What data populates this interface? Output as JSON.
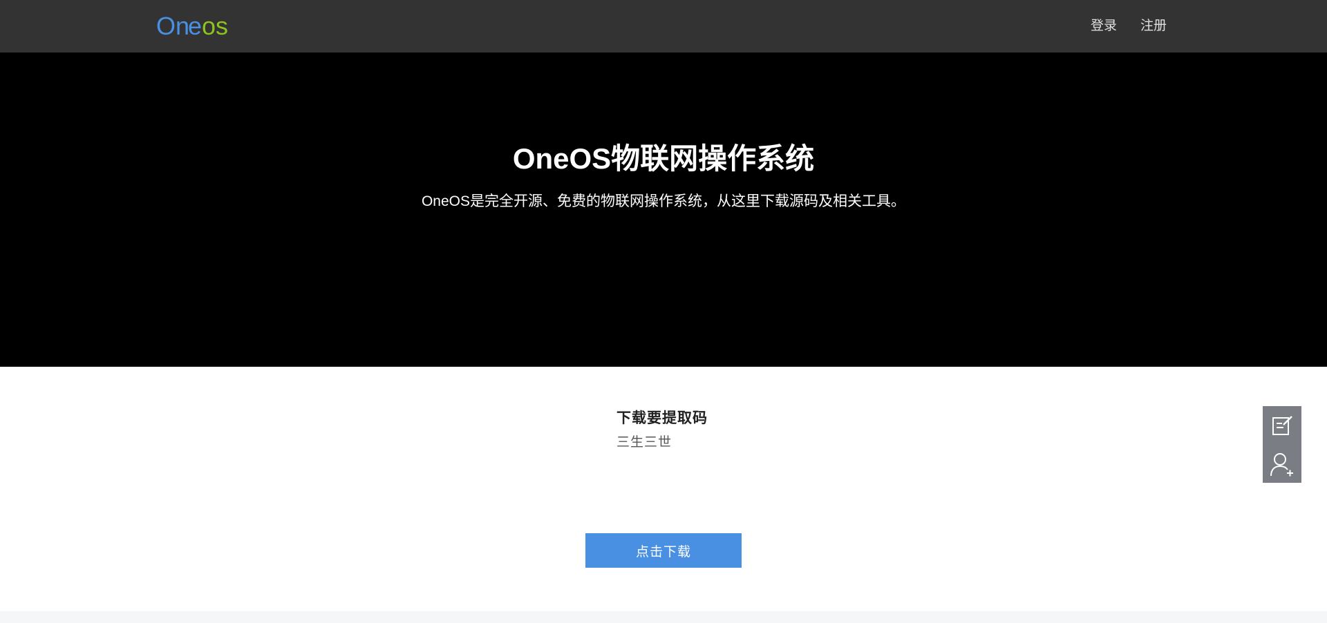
{
  "header": {
    "logo_text": "Oneos",
    "logo_colors": {
      "blue": "#4a90e2",
      "green": "#8dc21f"
    },
    "nav": {
      "login": "登录",
      "register": "注册"
    }
  },
  "hero": {
    "title": "OneOS物联网操作系统",
    "subtitle": "OneOS是完全开源、免费的物联网操作系统，从这里下载源码及相关工具。"
  },
  "download": {
    "code_label": "下载要提取码",
    "code_value": "三生三世",
    "button_label": "点击下载"
  },
  "side_toolbar": {
    "items": [
      {
        "icon": "edit-note-icon"
      },
      {
        "icon": "add-user-icon"
      }
    ]
  },
  "colors": {
    "header_bg": "#333333",
    "hero_bg": "#000000",
    "button_bg": "#4a90e2",
    "toolbar_bg": "#7a7d84"
  }
}
